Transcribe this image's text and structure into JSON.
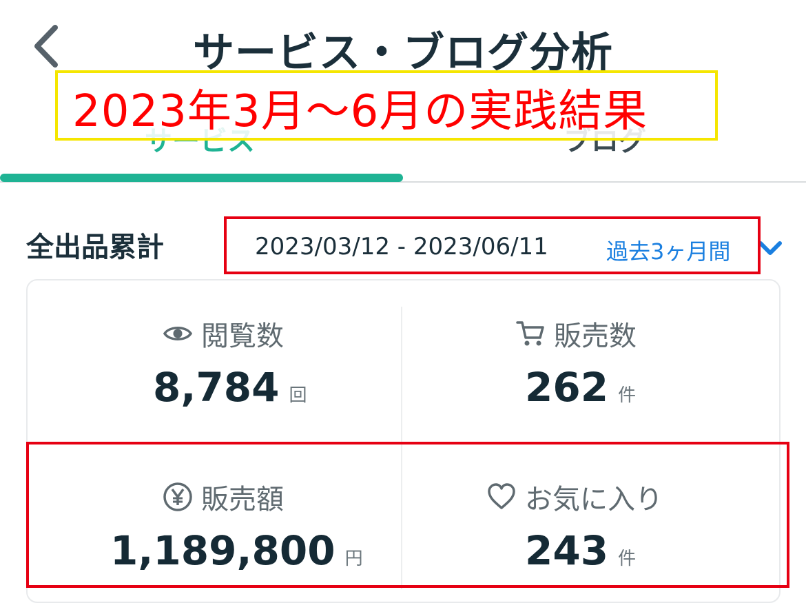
{
  "header": {
    "title": "サービス・ブログ分析",
    "back_icon": "chevron-left-icon"
  },
  "annotation": {
    "text": "2023年3月〜6月の実践結果"
  },
  "tabs": [
    {
      "label": "サービス",
      "active": true
    },
    {
      "label": "ブログ",
      "active": false
    }
  ],
  "section": {
    "title": "全出品累計",
    "date_range": "2023/03/12 - 2023/06/11",
    "period": "過去3ヶ月間"
  },
  "stats": {
    "views": {
      "label": "閲覧数",
      "value": "8,784",
      "unit": "回",
      "icon": "eye-icon"
    },
    "sales": {
      "label": "販売数",
      "value": "262",
      "unit": "件",
      "icon": "cart-icon"
    },
    "revenue": {
      "label": "販売額",
      "value": "1,189,800",
      "unit": "円",
      "icon": "yen-icon"
    },
    "favorites": {
      "label": "お気に入り",
      "value": "243",
      "unit": "件",
      "icon": "heart-icon"
    }
  },
  "colors": {
    "accent": "#1fb394",
    "link": "#1a7fe0",
    "highlight_red": "#e60012",
    "highlight_yellow": "#f5e600",
    "annotation_text": "#ff0000"
  }
}
